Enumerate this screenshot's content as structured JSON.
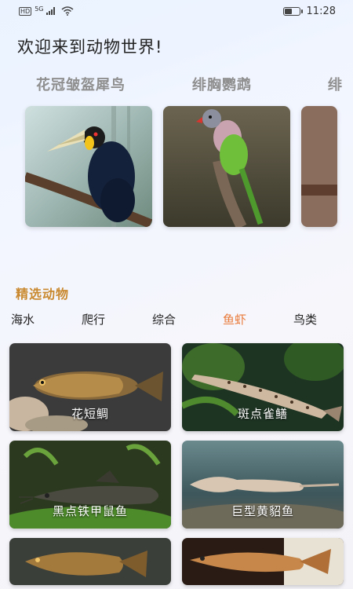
{
  "status_bar": {
    "network_badge": "HD",
    "network_type": "5G",
    "time": "11:28",
    "battery_level": 0.55
  },
  "welcome_text": "欢迎来到动物世界!",
  "carousel": {
    "items": [
      {
        "title": "花冠皱盔犀鸟"
      },
      {
        "title": "绯胸鹦鹉"
      },
      {
        "title": "绯"
      }
    ]
  },
  "featured": {
    "title": "精选动物",
    "tabs": [
      {
        "label": "海水"
      },
      {
        "label": "爬行"
      },
      {
        "label": "综合"
      },
      {
        "label": "鱼虾"
      },
      {
        "label": "鸟类"
      }
    ],
    "active_tab": "鱼虾",
    "cards": [
      {
        "name": "花短鲷"
      },
      {
        "name": "斑点雀鳝"
      },
      {
        "name": "黑点铁甲鼠鱼"
      },
      {
        "name": "巨型黄貂鱼"
      },
      {
        "name": ""
      },
      {
        "name": ""
      }
    ]
  },
  "colors": {
    "accent": "#ea7a3a",
    "section_title": "#c9892e",
    "carousel_title": "#8f8f8f"
  }
}
